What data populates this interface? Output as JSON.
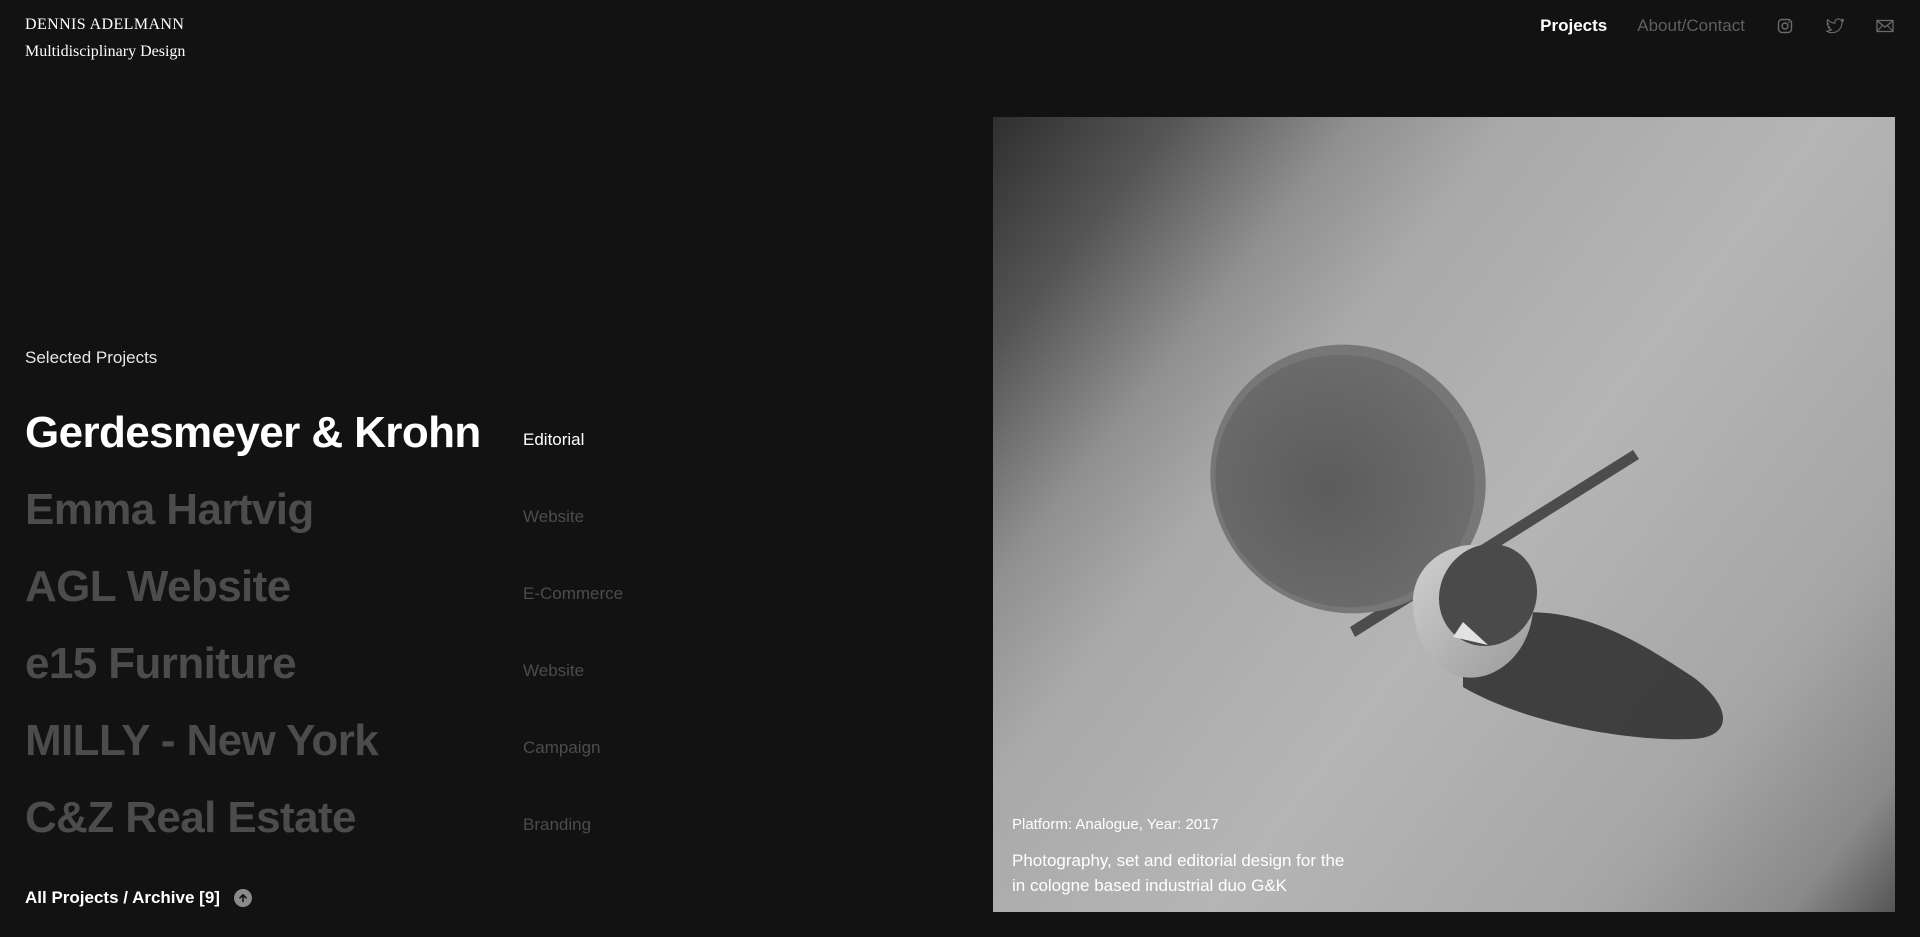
{
  "brand": {
    "name": "DENNIS ADELMANN",
    "tagline": "Multidisciplinary Design"
  },
  "nav": {
    "projects": "Projects",
    "about": "About/Contact",
    "icons": [
      "instagram-icon",
      "twitter-icon",
      "mail-icon"
    ]
  },
  "main": {
    "section_title": "Selected Projects",
    "projects": [
      {
        "name": "Gerdesmeyer & Krohn",
        "type": "Editorial",
        "active": true
      },
      {
        "name": "Emma Hartvig",
        "type": "Website",
        "active": false
      },
      {
        "name": "AGL Website",
        "type": "E-Commerce",
        "active": false
      },
      {
        "name": "e15 Furniture",
        "type": "Website",
        "active": false
      },
      {
        "name": "MILLY - New York",
        "type": "Campaign",
        "active": false
      },
      {
        "name": "C&Z Real Estate",
        "type": "Branding",
        "active": false
      }
    ],
    "archive_label": "All Projects / Archive [9]"
  },
  "feature": {
    "meta": "Platform: Analogue, Year: 2017",
    "description": "Photography, set and editorial design for the in cologne based industrial duo G&K"
  },
  "colors": {
    "background": "#121212",
    "active_text": "#ffffff",
    "inactive_text": "#4c4c4c"
  }
}
